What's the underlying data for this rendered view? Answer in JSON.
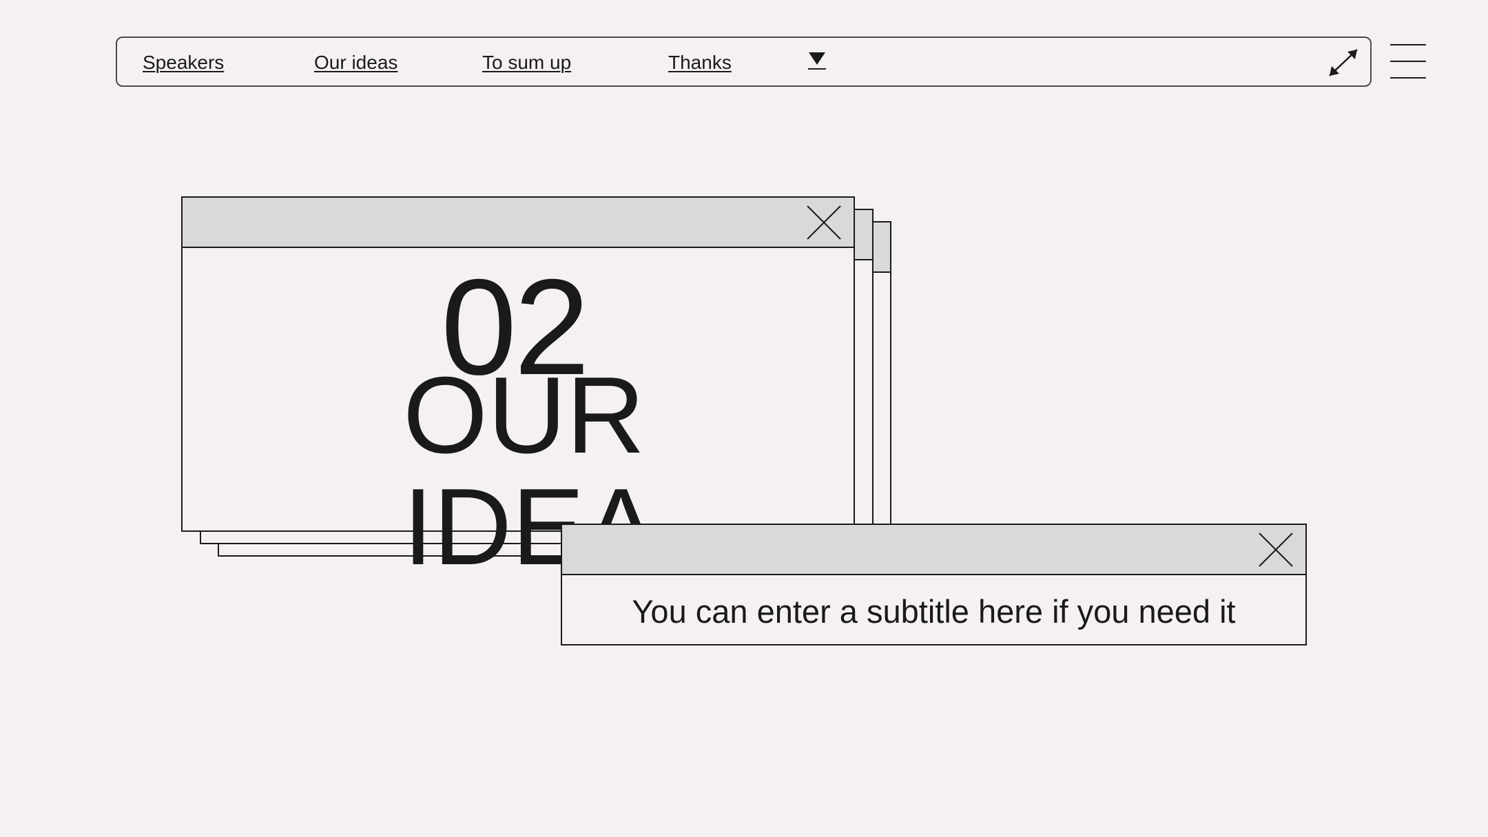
{
  "nav": {
    "links": [
      {
        "label": "Speakers"
      },
      {
        "label": "Our ideas"
      },
      {
        "label": "To sum up"
      },
      {
        "label": "Thanks"
      }
    ],
    "dropdown_icon": "triangle-down-icon",
    "expand_icon": "expand-arrows-icon",
    "menu_icon": "hamburger-menu-icon"
  },
  "slide": {
    "section_number": "02",
    "section_title": "OUR IDEA"
  },
  "subtitle_window": {
    "text": "You can enter a subtitle here if you need it"
  },
  "colors": {
    "background": "#f6f1f1",
    "titlebar": "#d9d9d9",
    "ink": "#1a1a1a"
  }
}
